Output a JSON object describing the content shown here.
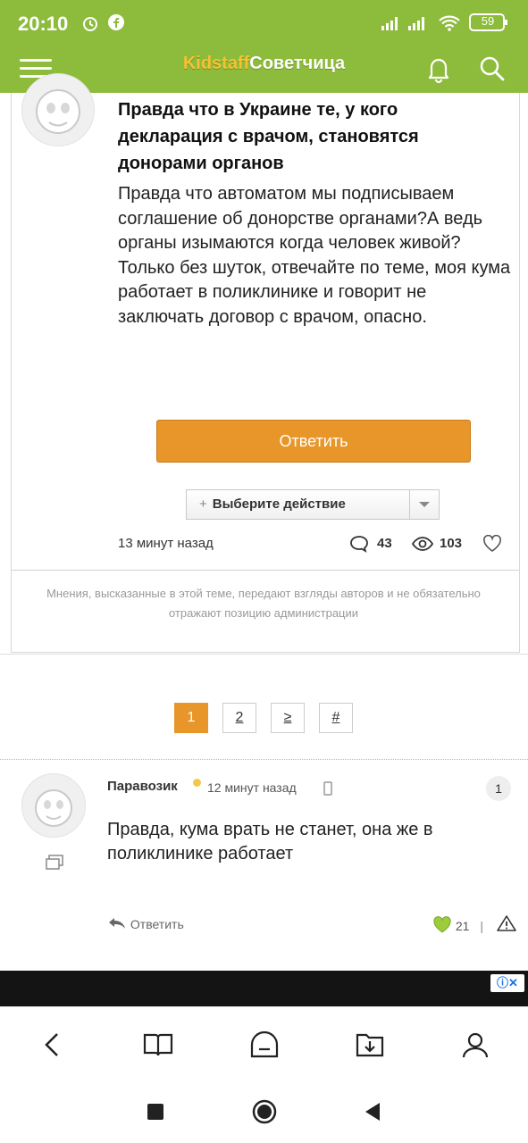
{
  "status_bar": {
    "time": "20:10",
    "battery": "59"
  },
  "header": {
    "logo_part1": "Kidstaff",
    "logo_part2": "Советчица"
  },
  "question": {
    "title": "Правда что в Украине те, у кого декларация с врачом, становятся донорами органов",
    "body": "Правда что автоматом мы подписываем соглашение об донорстве органами?А ведь органы изымаются когда человек живой?Только без шуток, отвечайте по теме, моя кума работает в поликлинике и говорит не заключать договор с врачом, опасно.",
    "reply_button": "Ответить",
    "action_select": "Выберите действие",
    "time_ago": "13 минут назад",
    "comments_count": "43",
    "views_count": "103",
    "disclaimer": "Мнения, высказанные в этой теме, передают взгляды авторов и не обязательно отражают позицию администрации"
  },
  "pagination": {
    "pages": [
      "1",
      "2",
      "≥",
      "#"
    ],
    "current": "1"
  },
  "comment": {
    "author": "Паравозик",
    "time_ago": "12 минут назад",
    "number": "1",
    "text": "Правда, кума врать не станет, она же в поликлинике работает",
    "reply_label": "Ответить",
    "likes": "21",
    "like_separator": "|"
  },
  "colors": {
    "brand_green": "#8dbb3c",
    "accent_orange": "#e8962a"
  },
  "icons": [
    "menu-icon",
    "bell-icon",
    "search-icon",
    "comment-icon",
    "eye-icon",
    "heart-icon",
    "reply-arrow-icon",
    "warning-icon",
    "chat-icon",
    "back-icon",
    "book-icon",
    "home-icon",
    "download-icon",
    "profile-icon",
    "stop-icon",
    "circle-icon",
    "triangle-icon"
  ]
}
